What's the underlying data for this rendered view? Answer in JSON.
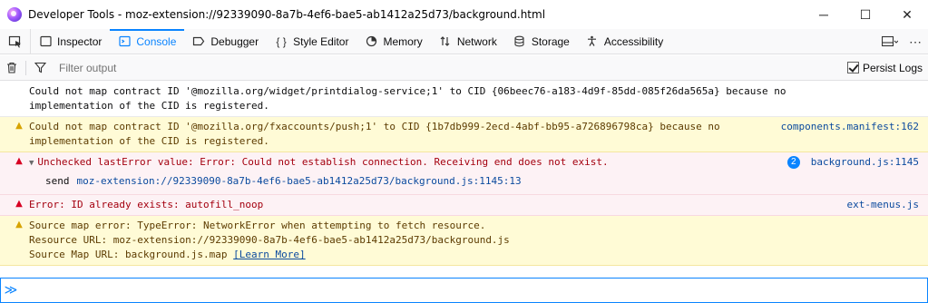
{
  "window": {
    "title": "Developer Tools - moz-extension://92339090-8a7b-4ef6-bae5-ab1412a25d73/background.html",
    "controls": {
      "minimize": "─",
      "maximize": "☐",
      "close": "✕"
    }
  },
  "toolbar": {
    "tabs": [
      {
        "label": "Inspector",
        "icon": "inspector-icon",
        "glyph": "▢"
      },
      {
        "label": "Console",
        "icon": "console-icon",
        "glyph": "⊡",
        "active": true
      },
      {
        "label": "Debugger",
        "icon": "debugger-icon",
        "glyph": "⬭"
      },
      {
        "label": "Style Editor",
        "icon": "style-editor-icon",
        "glyph": "{ }"
      },
      {
        "label": "Memory",
        "icon": "memory-icon",
        "glyph": "◔"
      },
      {
        "label": "Network",
        "icon": "network-icon",
        "glyph": "⇅"
      },
      {
        "label": "Storage",
        "icon": "storage-icon",
        "glyph": "☰"
      },
      {
        "label": "Accessibility",
        "icon": "accessibility-icon",
        "glyph": "♿"
      }
    ],
    "accent": "#0a84ff"
  },
  "filterbar": {
    "placeholder": "Filter output",
    "persist_label": "Persist Logs",
    "persist_checked": true
  },
  "messages": [
    {
      "level": "log",
      "text": "Could not map contract ID '@mozilla.org/widget/printdialog-service;1' to CID {06beec76-a183-4d9f-85dd-085f26da565a} because no implementation of the CID is registered.",
      "source": ""
    },
    {
      "level": "warn",
      "text": "Could not map contract ID '@mozilla.org/fxaccounts/push;1' to CID {1b7db999-2ecd-4abf-bb95-a726896798ca} because no implementation of the CID is registered.",
      "source": "components.manifest:162"
    },
    {
      "level": "error",
      "text": "Unchecked lastError value: Error: Could not establish connection. Receiving end does not exist.",
      "source": "background.js:1145",
      "repeat": "2",
      "stack_fn": "send",
      "stack_loc": "moz-extension://92339090-8a7b-4ef6-bae5-ab1412a25d73/background.js:1145:13"
    },
    {
      "level": "error",
      "text": "Error: ID already exists: autofill_noop",
      "source": "ext-menus.js"
    },
    {
      "level": "warn",
      "text_line1": "Source map error: TypeError: NetworkError when attempting to fetch resource.",
      "text_line2": "Resource URL: moz-extension://92339090-8a7b-4ef6-bae5-ab1412a25d73/background.js",
      "text_line3": "Source Map URL: background.js.map",
      "link_label": "[Learn More]",
      "source": ""
    }
  ],
  "jsterm": {
    "prompt": "≫",
    "value": ""
  }
}
